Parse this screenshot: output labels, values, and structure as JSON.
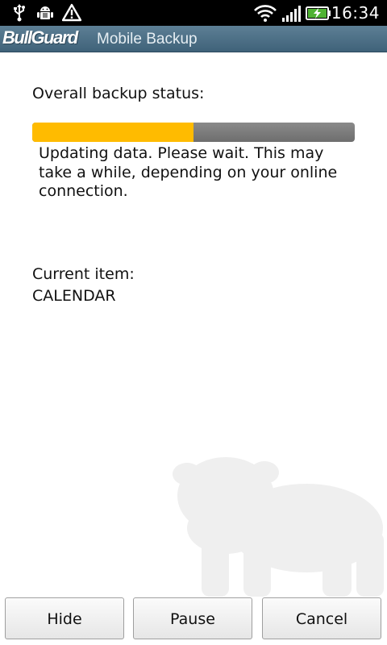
{
  "status_bar": {
    "time": "16:34",
    "icons": [
      "usb-icon",
      "android-debug-icon",
      "warning-icon",
      "wifi-icon",
      "signal-icon",
      "battery-charging-icon"
    ]
  },
  "app": {
    "brand": "BullGuard",
    "product": "Mobile Backup"
  },
  "backup": {
    "overall_label": "Overall backup status:",
    "progress_fraction": 0.5,
    "message": "Updating data. Please wait. This may take a while, depending on your online connection.",
    "current_label": "Current item:",
    "current_value": "CALENDAR"
  },
  "buttons": {
    "hide": "Hide",
    "pause": "Pause",
    "cancel": "Cancel"
  },
  "colors": {
    "progress_fill": "#ffbb00",
    "progress_track": "#7c7c7c",
    "title_bar": "#4d7088"
  }
}
